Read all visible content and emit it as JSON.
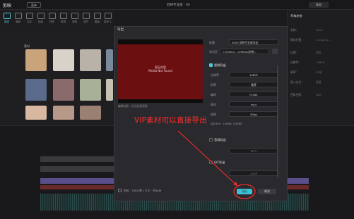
{
  "app": {
    "logo": "剪映",
    "menu": "菜单",
    "window_title": "剪映专业版 - 00",
    "export_top": "导出"
  },
  "toolbar": {
    "tools": [
      {
        "label": "媒体"
      },
      {
        "label": "音频"
      },
      {
        "label": "文本"
      },
      {
        "label": "贴纸"
      },
      {
        "label": "特效"
      },
      {
        "label": "转场"
      },
      {
        "label": "滤镜"
      },
      {
        "label": "调节"
      },
      {
        "label": "模板"
      },
      {
        "label": "数字人"
      }
    ]
  },
  "left_panel": {
    "section_label": "素材"
  },
  "right_panel": {
    "title": "草稿参数",
    "rows": [
      {
        "k": "名称：",
        "v": "0000"
      },
      {
        "k": "保存位置：",
        "v": "C:/Users/..."
      },
      {
        "k": "比例：",
        "v": "适应"
      },
      {
        "k": "分辨率：",
        "v": "1080P"
      },
      {
        "k": "帧率：",
        "v": "30帧"
      },
      {
        "k": "导入方式：",
        "v": "保留"
      },
      {
        "k": "色彩空间：",
        "v": "SDR"
      }
    ]
  },
  "modal": {
    "title": "导出",
    "preview_text_1": "暂无内容",
    "preview_text_2": "Media Not Found",
    "edit_cover": "编辑封面 · 标记封面视频",
    "name_label": "标题",
    "name_value": "0000 剪映专业版导出",
    "path_label": "导出至",
    "path_value": "C:/Users/..../Videos/剪映...",
    "video_section": "视频导出",
    "fields": [
      {
        "label": "分辨率",
        "value": "1080P"
      },
      {
        "label": "码率",
        "value": "推荐"
      },
      {
        "label": "编码",
        "value": "H.264"
      },
      {
        "label": "格式",
        "value": "mp4"
      },
      {
        "label": "帧率",
        "value": "30fps"
      }
    ],
    "size_estimate": "估计大小：100MB（4分/秒）",
    "audio_section": "音频导出",
    "audio_format": "MP3",
    "gif_section": "GIF导出",
    "gif_value": "240P",
    "footer_info": "时长：1分20秒 | 大小：约40M",
    "export_label": "导出",
    "cancel_label": "取消"
  },
  "annotation": "VIP素材可以直接导出",
  "colors": {
    "accent": "#3fc1d4",
    "annotation": "#ff2a2a",
    "preview_bg": "#6b0f10"
  }
}
